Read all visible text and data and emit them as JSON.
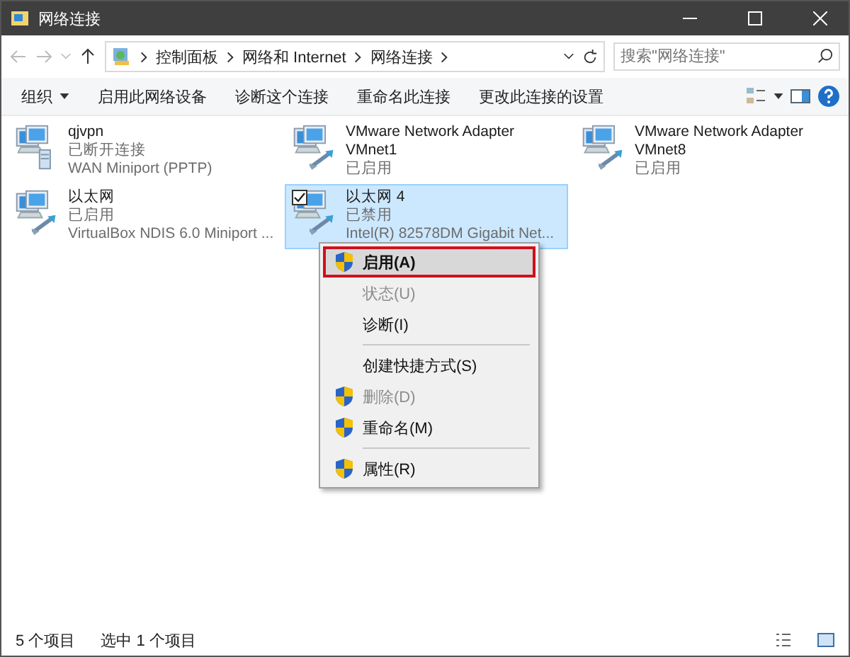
{
  "window": {
    "title": "网络连接"
  },
  "address_bar": {
    "breadcrumbs": [
      "控制面板",
      "网络和 Internet",
      "网络连接"
    ],
    "search": {
      "placeholder": "搜索\"网络连接\""
    }
  },
  "toolbar": {
    "buttons": [
      {
        "label": "组织",
        "dropdown": true
      },
      {
        "label": "启用此网络设备",
        "dropdown": false
      },
      {
        "label": "诊断这个连接",
        "dropdown": false
      },
      {
        "label": "重命名此连接",
        "dropdown": false
      },
      {
        "label": "更改此连接的设置",
        "dropdown": false
      }
    ]
  },
  "connections": [
    {
      "kind": "vpn",
      "name": "qjvpn",
      "status": "已断开连接",
      "device": "WAN Miniport (PPTP)",
      "selected": false,
      "checked": false
    },
    {
      "kind": "ethernet",
      "name": "VMware Network Adapter VMnet1",
      "status": "已启用",
      "selected": false,
      "checked": false
    },
    {
      "kind": "ethernet",
      "name": "VMware Network Adapter VMnet8",
      "status": "已启用",
      "selected": false,
      "checked": false
    },
    {
      "kind": "ethernet",
      "name": "以太网",
      "status": "已启用",
      "device": "VirtualBox NDIS 6.0 Miniport ...",
      "selected": false,
      "checked": false
    },
    {
      "kind": "ethernet",
      "name": "以太网 4",
      "status": "已禁用",
      "device": "Intel(R) 82578DM Gigabit Net...",
      "selected": true,
      "checked": true
    }
  ],
  "context_menu": [
    {
      "kind": "item",
      "label": "启用(A)",
      "shield": true,
      "disabled": false,
      "bold": true,
      "selected": true
    },
    {
      "kind": "item",
      "label": "状态(U)",
      "shield": false,
      "disabled": true,
      "bold": false,
      "selected": false
    },
    {
      "kind": "item",
      "label": "诊断(I)",
      "shield": false,
      "disabled": false,
      "bold": false,
      "selected": false
    },
    {
      "kind": "separator"
    },
    {
      "kind": "item",
      "label": "创建快捷方式(S)",
      "shield": false,
      "disabled": false,
      "bold": false,
      "selected": false
    },
    {
      "kind": "item",
      "label": "删除(D)",
      "shield": true,
      "disabled": true,
      "bold": false,
      "selected": false
    },
    {
      "kind": "item",
      "label": "重命名(M)",
      "shield": true,
      "disabled": false,
      "bold": false,
      "selected": false
    },
    {
      "kind": "separator"
    },
    {
      "kind": "item",
      "label": "属性(R)",
      "shield": true,
      "disabled": false,
      "bold": false,
      "selected": false
    }
  ],
  "status_bar": {
    "count": "5 个项目",
    "selection": "选中 1 个项目"
  }
}
